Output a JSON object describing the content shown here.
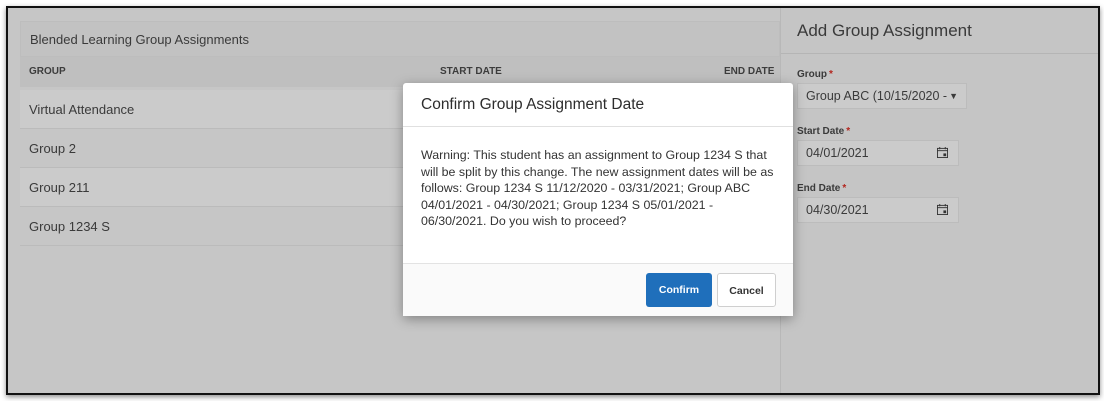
{
  "left_panel": {
    "title": "Blended Learning Group Assignments",
    "columns": [
      "GROUP",
      "START DATE",
      "END DATE"
    ],
    "rows": [
      "Virtual Attendance",
      "Group 2",
      "Group 211",
      "Group 1234 S"
    ]
  },
  "right_panel": {
    "title": "Add Group Assignment",
    "group_label": "Group",
    "group_value": "Group ABC (10/15/2020 -",
    "start_label": "Start Date",
    "start_value": "04/01/2021",
    "end_label": "End Date",
    "end_value": "04/30/2021",
    "required_mark": "*"
  },
  "modal": {
    "title": "Confirm Group Assignment Date",
    "message_lines": [
      "Warning: This student has an assignment to Group 1234 S that",
      "will be split by this change. The new assignment dates will be as",
      "follows: Group 1234 S 11/12/2020 - 03/31/2021; Group ABC",
      "04/01/2021 - 04/30/2021; Group 1234 S 05/01/2021 -",
      "06/30/2021. Do you wish to proceed?"
    ],
    "confirm_label": "Confirm",
    "cancel_label": "Cancel"
  },
  "colors": {
    "primary_button": "#1f6fbb",
    "required": "#b3261e",
    "overlay": "#c6c6c6"
  },
  "icons": {
    "calendar": "calendar-icon",
    "dropdown": "chevron-down-icon"
  }
}
